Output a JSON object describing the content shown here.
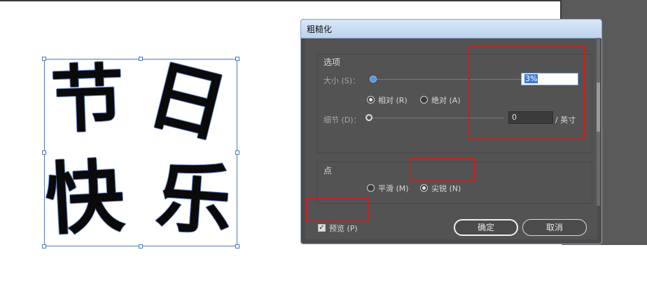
{
  "artwork": {
    "glyphs": [
      "节",
      "日",
      "快",
      "乐"
    ]
  },
  "dialog": {
    "title": "粗糙化",
    "options_group": {
      "label": "选项",
      "size_label": "大小 (S)：",
      "size_value": "3%",
      "relative_label": "相对 (R)",
      "absolute_label": "绝对 (A)",
      "selected_mode": "relative",
      "detail_label": "细节 (D)：",
      "detail_value": "0",
      "detail_unit": "/ 英寸"
    },
    "points_group": {
      "label": "点",
      "smooth_label": "平滑 (M)",
      "corner_label": "尖锐 (N)",
      "selected": "corner"
    },
    "preview_label": "预览 (P)",
    "preview_checked": true,
    "ok_label": "确定",
    "cancel_label": "取消"
  },
  "colors": {
    "highlight": "#cc1f1f",
    "dialog_bg": "#535353",
    "selection": "#4a78c8"
  }
}
